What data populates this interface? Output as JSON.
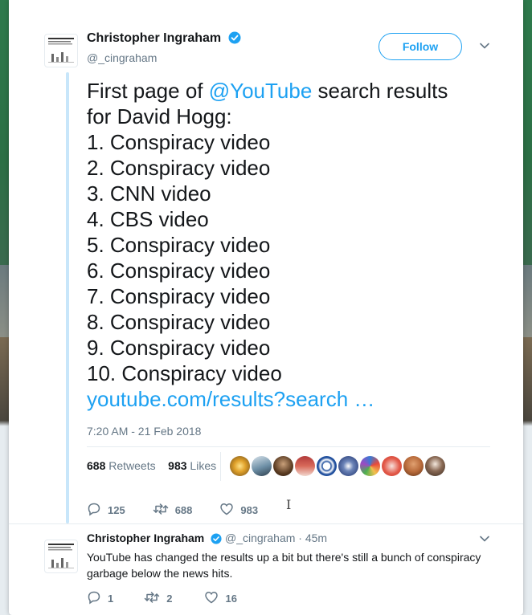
{
  "tweet": {
    "author_name": "Christopher Ingraham",
    "handle": "@_cingraham",
    "follow_label": "Follow",
    "text_lines": [
      {
        "prefix": "First page of ",
        "mention": "@YouTube",
        "suffix": " search results"
      },
      {
        "text": "for David Hogg:"
      },
      {
        "text": "1. Conspiracy video"
      },
      {
        "text": "2. Conspiracy video"
      },
      {
        "text": "3. CNN video"
      },
      {
        "text": "4. CBS video"
      },
      {
        "text": "5. Conspiracy video"
      },
      {
        "text": "6. Conspiracy video"
      },
      {
        "text": "7. Conspiracy video"
      },
      {
        "text": "8. Conspiracy video"
      },
      {
        "text": "9. Conspiracy video"
      },
      {
        "text": "10. Conspiracy video"
      }
    ],
    "link_text": "youtube.com/results?search …",
    "timestamp": "7:20 AM - 21 Feb 2018",
    "retweets_count": "688",
    "retweets_label": "Retweets",
    "likes_count": "983",
    "likes_label": "Likes",
    "actions": {
      "reply_count": "125",
      "retweet_count": "688",
      "like_count": "983"
    }
  },
  "reply": {
    "author_name": "Christopher Ingraham",
    "handle": "@_cingraham",
    "separator": " · ",
    "time": "45m",
    "text": "YouTube has changed the results up a bit but there's still a bunch of conspiracy garbage below the news hits.",
    "actions": {
      "reply_count": "1",
      "retweet_count": "2",
      "like_count": "16"
    }
  },
  "colors": {
    "accent": "#1da1f2",
    "muted": "#657786",
    "text": "#14171a",
    "thread_line": "#c8e6fa"
  },
  "icons": [
    "verified-icon",
    "chevron-down-icon",
    "reply-icon",
    "retweet-icon",
    "like-icon",
    "text-cursor-icon"
  ]
}
